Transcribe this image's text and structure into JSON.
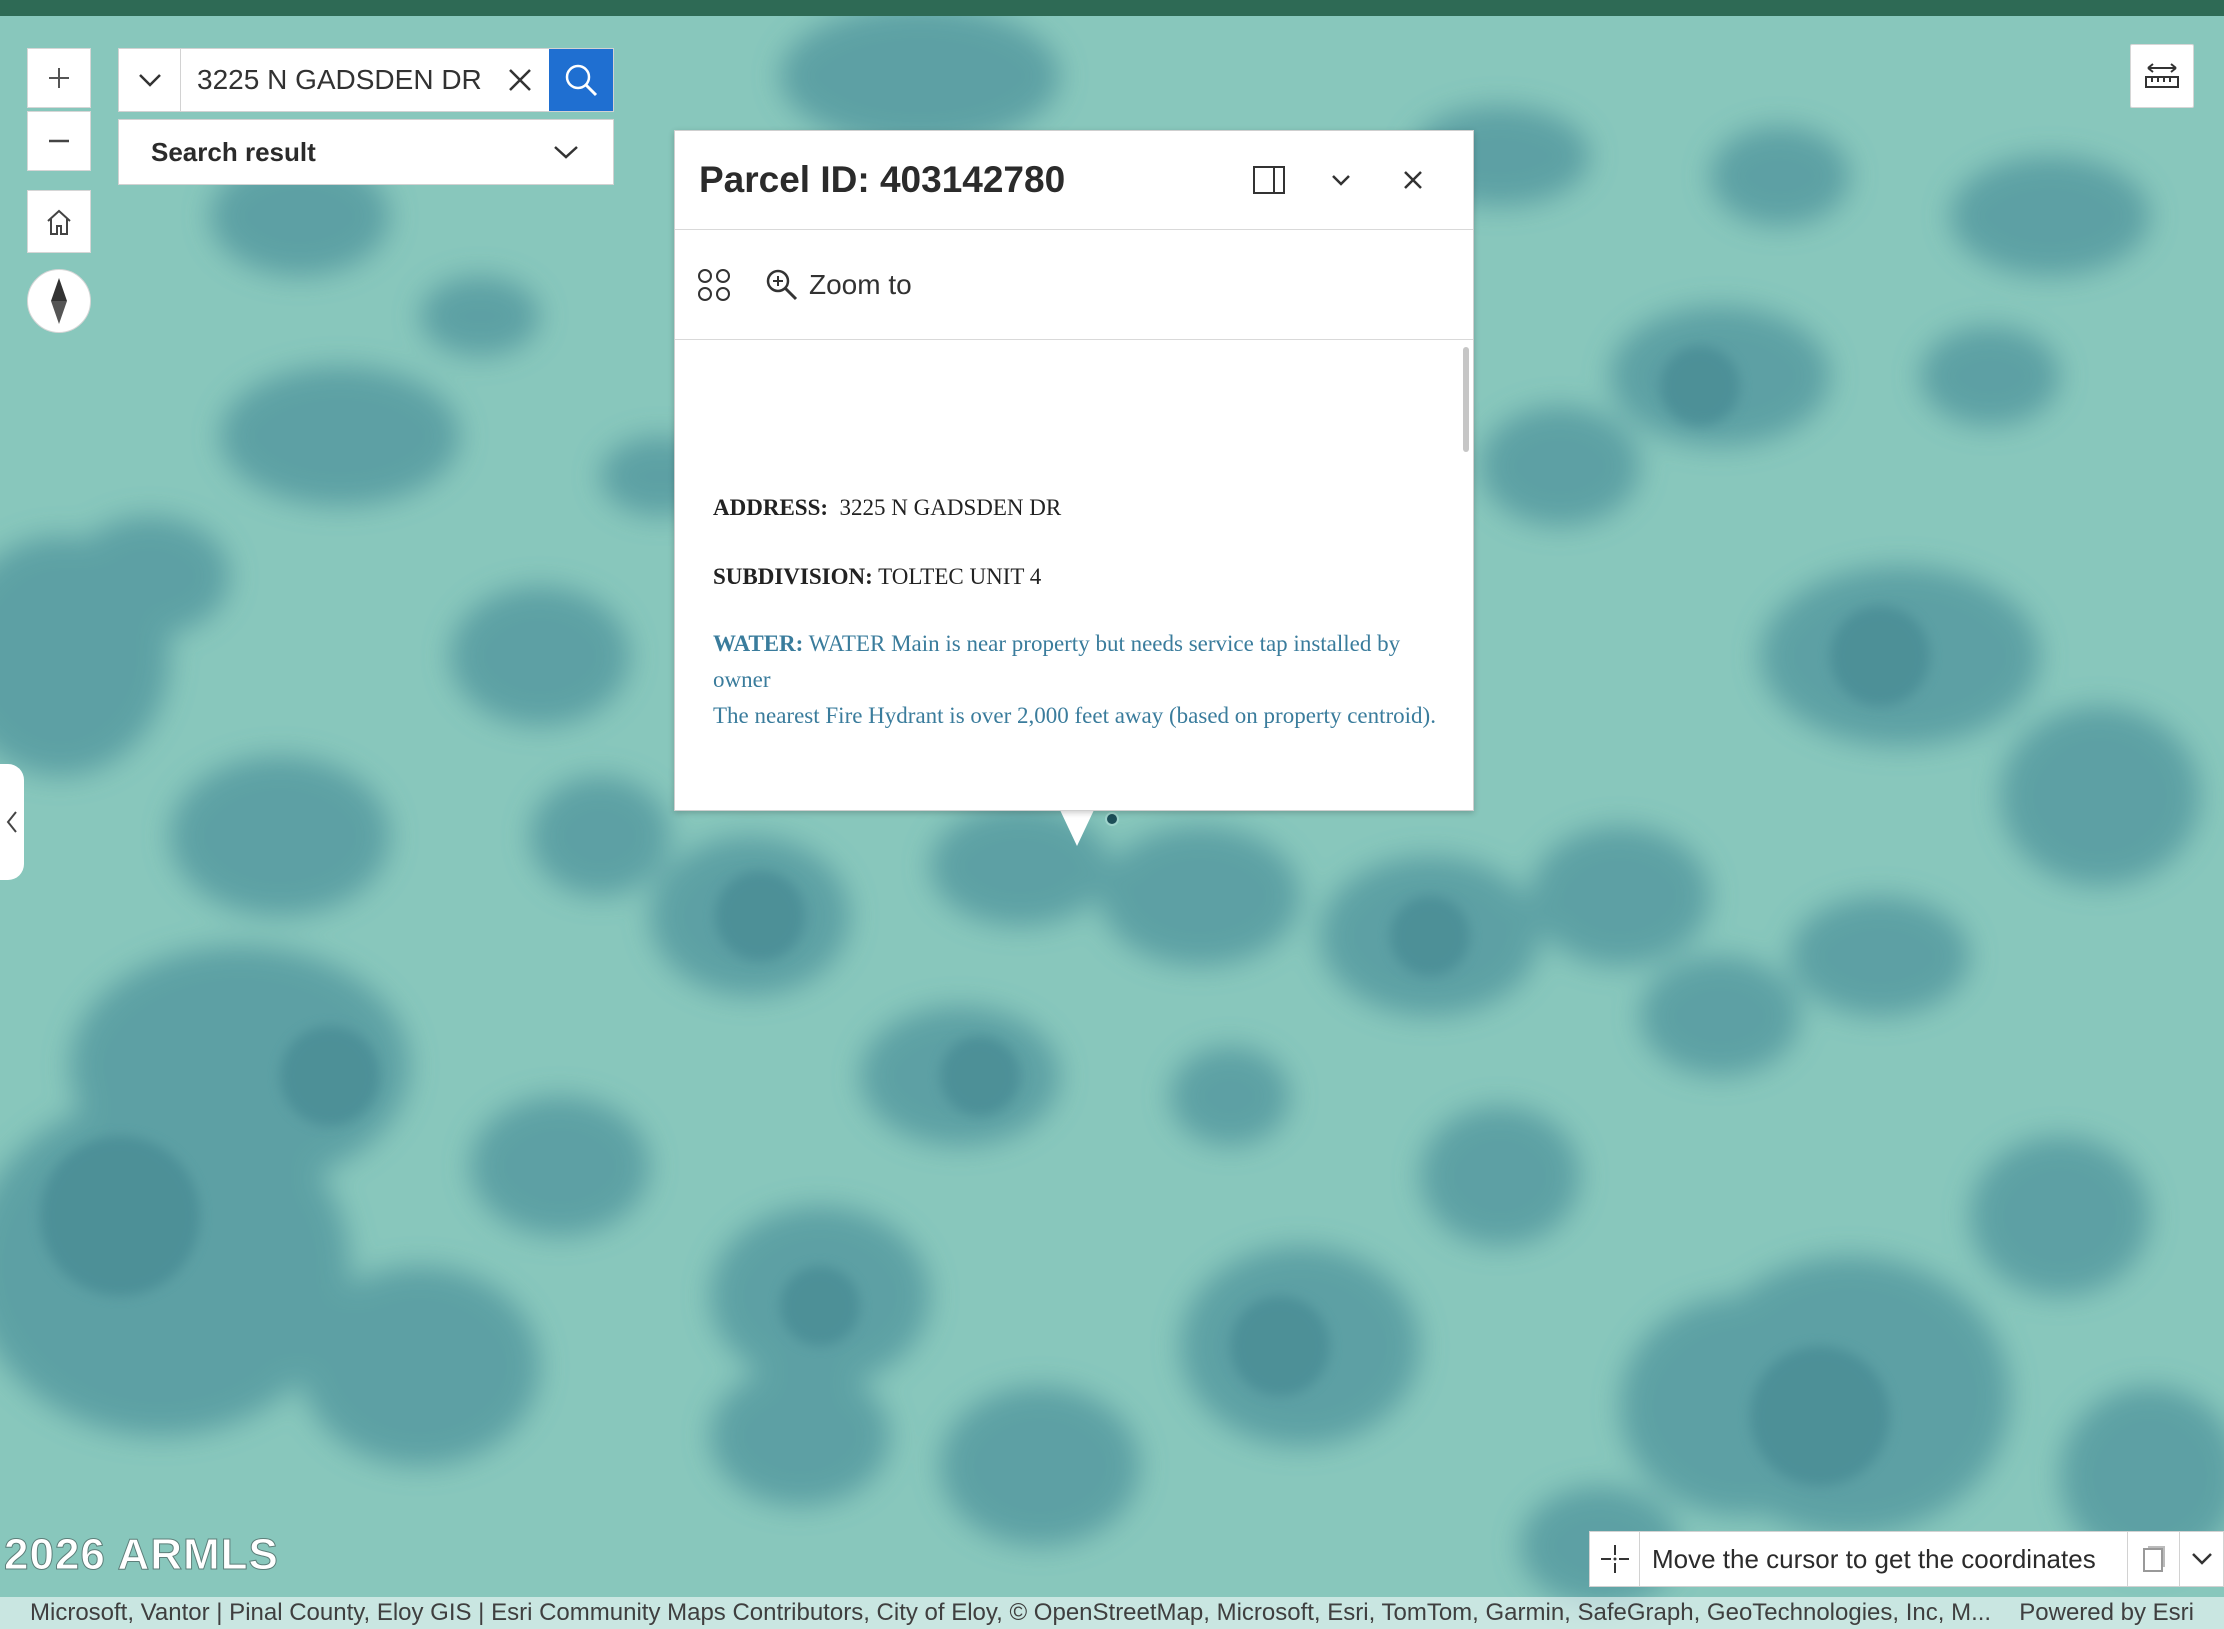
{
  "search": {
    "value": "3225 N GADSDEN DR",
    "result_label": "Search result"
  },
  "popup": {
    "title": "Parcel ID: 403142780",
    "zoom_to_label": "Zoom to",
    "fields": {
      "address_label": "ADDRESS:",
      "address_value": "3225 N GADSDEN DR",
      "subdivision_label": "SUBDIVISION:",
      "subdivision_value": "TOLTEC UNIT 4",
      "water_label": "WATER:",
      "water_value": "WATER Main is near property but needs service tap installed by owner",
      "hydrant_note": "The nearest Fire Hydrant is over 2,000 feet away (based on property centroid)."
    }
  },
  "map_overlay": {
    "copyright": "2026 ARMLS"
  },
  "coordinates": {
    "text": "Move the cursor to get the coordinates"
  },
  "attribution": {
    "text": "Microsoft, Vantor | Pinal County, Eloy GIS | Esri Community Maps Contributors, City of Eloy, © OpenStreetMap, Microsoft, Esri, TomTom, Garmin, SafeGraph, GeoTechnologies, Inc, M...",
    "powered_by": "Powered by Esri"
  },
  "colors": {
    "map_base": "#86c5bb",
    "vegetation": "#5a9fa3",
    "header_bar": "#2e6a55",
    "search_button": "#1f6fd1",
    "water_text": "#3a7c9c"
  },
  "icons": [
    "zoom-in-icon",
    "zoom-out-icon",
    "home-icon",
    "compass-icon",
    "measure-icon",
    "chevron-down-icon",
    "close-icon",
    "search-icon",
    "dock-icon",
    "collapse-icon",
    "grid-icon",
    "zoom-to-icon",
    "chevron-left-icon",
    "crosshair-icon",
    "copy-icon"
  ]
}
